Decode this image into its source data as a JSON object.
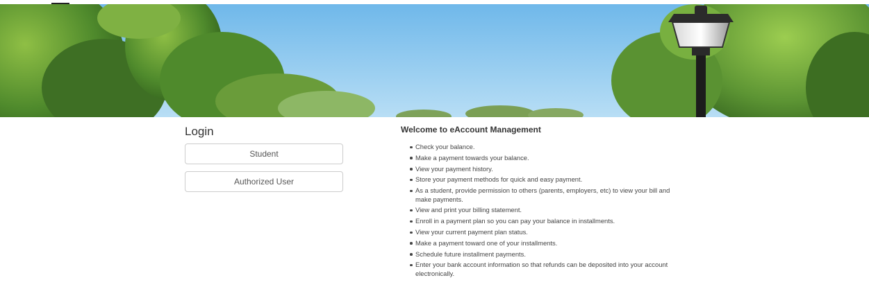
{
  "banner": {
    "description_icon": "campus-banner-image",
    "sky_color": "#8ecbf0",
    "foliage_color": "#3f7a2a"
  },
  "login": {
    "title": "Login",
    "buttons": [
      {
        "label": "Student"
      },
      {
        "label": "Authorized User"
      }
    ]
  },
  "welcome": {
    "title": "Welcome to eAccount Management",
    "items": [
      "Check your balance.",
      "Make a payment towards your balance.",
      "View your payment history.",
      "Store your payment methods for quick and easy payment.",
      "As a student, provide permission to others (parents, employers, etc) to view your bill and make payments.",
      "View and print your billing statement.",
      "Enroll in a payment plan so you can pay your balance in installments.",
      "View your current payment plan status.",
      "Make a payment toward one of your installments.",
      "Schedule future installment payments.",
      "Enter your bank account information so that refunds can be deposited into your account electronically."
    ]
  }
}
